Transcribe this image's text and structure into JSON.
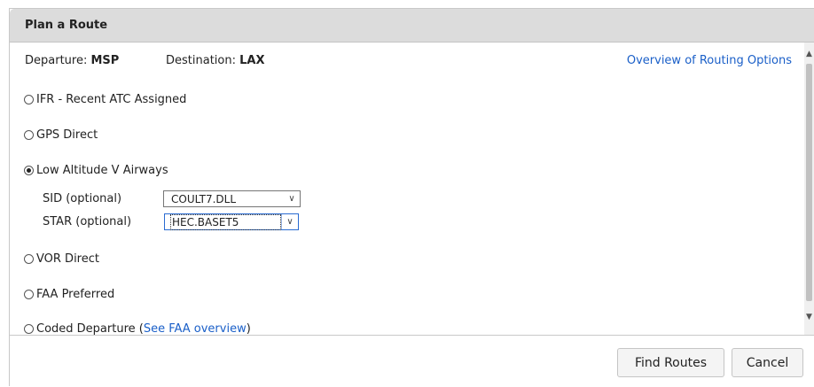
{
  "dialog": {
    "title": "Plan a Route",
    "departure_label": "Departure:",
    "departure_value": "MSP",
    "destination_label": "Destination:",
    "destination_value": "LAX",
    "overview_link": "Overview of Routing Options"
  },
  "options": [
    {
      "label": "IFR - Recent ATC Assigned",
      "selected": false
    },
    {
      "label": "GPS Direct",
      "selected": false
    },
    {
      "label": "Low Altitude V Airways",
      "selected": true
    },
    {
      "label": "VOR Direct",
      "selected": false
    },
    {
      "label": "FAA Preferred",
      "selected": false
    },
    {
      "label": "Coded Departure (",
      "link": "See FAA overview",
      "suffix": ")",
      "selected": false
    }
  ],
  "sid": {
    "label": "SID (optional)",
    "value": "COULT7.DLL"
  },
  "star": {
    "label": "STAR (optional)",
    "value": "HEC.BASET5"
  },
  "buttons": {
    "find": "Find Routes",
    "cancel": "Cancel"
  },
  "icons": {
    "select_arrow": "chevron-down-icon",
    "scroll_up": "scroll-up-icon",
    "scroll_down": "scroll-down-icon"
  }
}
